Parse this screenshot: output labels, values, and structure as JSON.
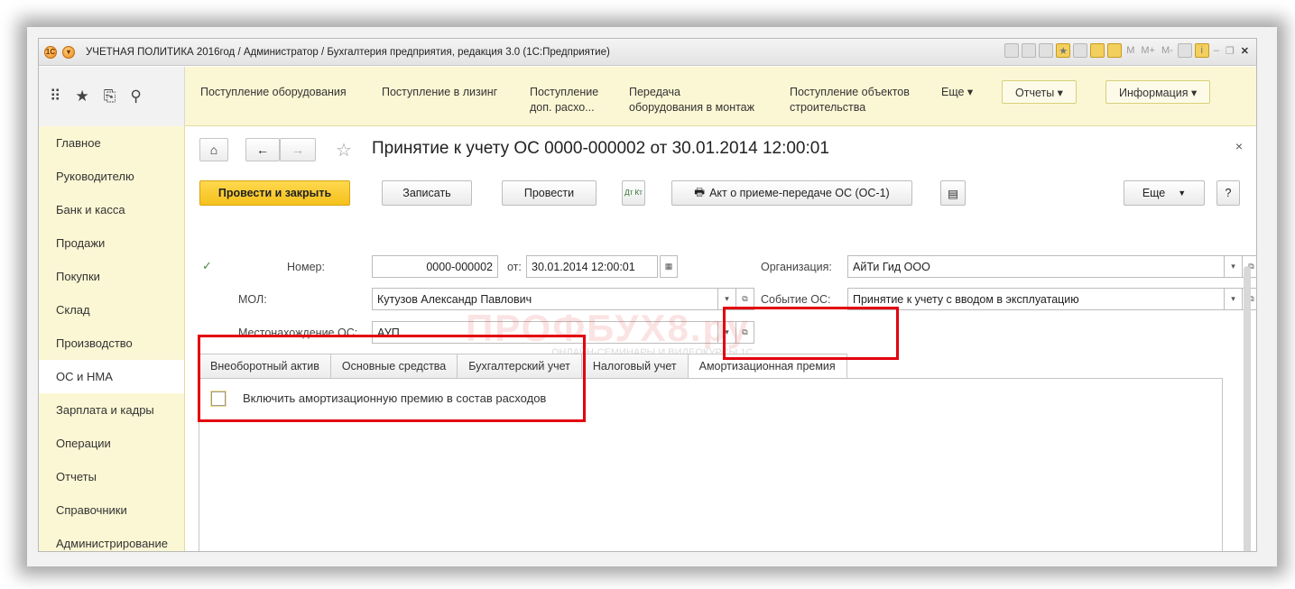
{
  "window": {
    "title": "УЧЕТНАЯ ПОЛИТИКА 2016год / Администратор / Бухгалтерия предприятия, редакция 3.0  (1С:Предприятие)",
    "tb_buttons": [
      "M",
      "M+",
      "M-"
    ]
  },
  "section_bar": {
    "links": [
      {
        "label": "Поступление оборудования"
      },
      {
        "label": "Поступление в лизинг"
      },
      {
        "label": "Поступление\nдоп. расхо..."
      },
      {
        "label": "Передача\nоборудования в монтаж"
      },
      {
        "label": "Поступление объектов\nстроительства"
      }
    ],
    "more": "Еще ▾",
    "reports": "Отчеты ▾",
    "info": "Информация ▾"
  },
  "menu": {
    "items": [
      "Главное",
      "Руководителю",
      "Банк и касса",
      "Продажи",
      "Покупки",
      "Склад",
      "Производство",
      "ОС и НМА",
      "Зарплата и кадры",
      "Операции",
      "Отчеты",
      "Справочники",
      "Администрирование"
    ],
    "active_index": 7
  },
  "document": {
    "title": "Принятие к учету ОС 0000-000002 от 30.01.2014 12:00:01",
    "close": "×",
    "toolbar": {
      "post_close": "Провести и закрыть",
      "save": "Записать",
      "post": "Провести",
      "dtkt": "Дт Кт",
      "act": "Акт о приеме-передаче ОС (ОС-1)",
      "more": "Еще",
      "help": "?"
    },
    "fields": {
      "number_label": "Номер:",
      "number_value": "0000-000002",
      "date_label": "от:",
      "date_value": "30.01.2014 12:00:01",
      "org_label": "Организация:",
      "org_value": "АйТи Гид ООО",
      "mol_label": "МОЛ:",
      "mol_value": "Кутузов Александр Павлович",
      "event_label": "Событие ОС:",
      "event_value": "Принятие к учету с вводом в эксплуатацию",
      "location_label": "Местонахождение ОС:",
      "location_value": "АУП"
    },
    "tabs": [
      "Внеоборотный актив",
      "Основные средства",
      "Бухгалтерский учет",
      "Налоговый учет",
      "Амортизационная премия"
    ],
    "active_tab": 4,
    "checkbox": {
      "label": "Включить амортизационную премию в состав расходов",
      "checked": false
    }
  },
  "watermark": {
    "main": "ПРОФБУХ8.ру",
    "sub": "ОНЛАЙН-СЕМИНАРЫ И ВИДЕОКУРСЫ 1С"
  },
  "colors": {
    "section_bg": "#fbf7d4",
    "primary_button": "#f5c11c",
    "highlight_box": "#e3000f"
  }
}
